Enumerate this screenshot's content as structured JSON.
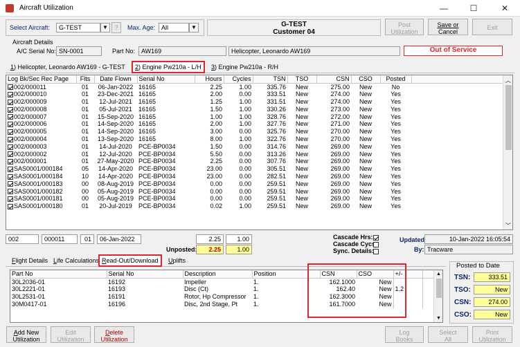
{
  "window": {
    "title": "Aircraft Utilization",
    "minimize": "—",
    "maximize": "☐",
    "close": "✕"
  },
  "header": {
    "select_aircraft_label": "Select Aircraft:",
    "select_aircraft_value": "G-TEST",
    "help": "?",
    "max_age_label": "Max. Age:",
    "max_age_value": "All",
    "aircraft_name": "G-TEST",
    "customer": "Customer 04",
    "post_label_1": "Post",
    "post_label_2": "Utilization",
    "save_label_1": "Save or",
    "save_label_2": "Cancel",
    "exit_label": "Exit"
  },
  "aircraft_details": {
    "group_label": "Aircraft Details",
    "serial_label": "A/C Serial No:",
    "serial_value": "SN-0001",
    "part_label": "Part No:",
    "part_value": "AW169",
    "description": "Helicopter, Leonardo AW169",
    "status": "Out of Service"
  },
  "tabs": [
    {
      "num": "1",
      "label": ") Helicopter, Leonardo AW169 - G-TEST"
    },
    {
      "num": "2",
      "label": ") Engine Pw210a - L/H"
    },
    {
      "num": "3",
      "label": ") Engine Pw210a - R/H"
    }
  ],
  "log_grid": {
    "columns": [
      "Log Bk/Sec Rec Page",
      "Flts",
      "Date Flown",
      "Serial No",
      "Hours",
      "Cycles",
      "TSN",
      "TSO",
      "CSN",
      "CSO",
      "Posted"
    ],
    "rows": [
      [
        "002/000011",
        "01",
        "06-Jan-2022",
        "16165",
        "2.25",
        "1.00",
        "335.76",
        "New",
        "275.00",
        "New",
        "No"
      ],
      [
        "002/000010",
        "01",
        "23-Dec-2021",
        "16165",
        "2.00",
        "0.00",
        "333.51",
        "New",
        "274.00",
        "New",
        "Yes"
      ],
      [
        "002/000009",
        "01",
        "12-Jul-2021",
        "16165",
        "1.25",
        "1.00",
        "331.51",
        "New",
        "274.00",
        "New",
        "Yes"
      ],
      [
        "002/000008",
        "01",
        "05-Jul-2021",
        "16165",
        "1.50",
        "1.00",
        "330.26",
        "New",
        "273.00",
        "New",
        "Yes"
      ],
      [
        "002/000007",
        "01",
        "15-Sep-2020",
        "16165",
        "1.00",
        "1.00",
        "328.76",
        "New",
        "272.00",
        "New",
        "Yes"
      ],
      [
        "002/000006",
        "01",
        "14-Sep-2020",
        "16165",
        "2.00",
        "1.00",
        "327.76",
        "New",
        "271.00",
        "New",
        "Yes"
      ],
      [
        "002/000005",
        "01",
        "14-Sep-2020",
        "16165",
        "3.00",
        "0.00",
        "325.76",
        "New",
        "270.00",
        "New",
        "Yes"
      ],
      [
        "002/000004",
        "01",
        "13-Sep-2020",
        "16165",
        "8.00",
        "1.00",
        "322.76",
        "New",
        "270.00",
        "New",
        "Yes"
      ],
      [
        "002/000003",
        "01",
        "14-Jul-2020",
        "PCE-BP0034",
        "1.50",
        "0.00",
        "314.76",
        "New",
        "269.00",
        "New",
        "Yes"
      ],
      [
        "002/000002",
        "01",
        "12-Jul-2020",
        "PCE-BP0034",
        "5.50",
        "0.00",
        "313.26",
        "New",
        "269.00",
        "New",
        "Yes"
      ],
      [
        "002/000001",
        "01",
        "27-May-2020",
        "PCE-BP0034",
        "2.25",
        "0.00",
        "307.76",
        "New",
        "269.00",
        "New",
        "Yes"
      ],
      [
        "SAS0001/000184",
        "05",
        "14-Apr-2020",
        "PCE-BP0034",
        "23.00",
        "0.00",
        "305.51",
        "New",
        "269.00",
        "New",
        "Yes"
      ],
      [
        "SAS0001/000184",
        "10",
        "14-Apr-2020",
        "PCE-BP0034",
        "23.00",
        "0.00",
        "282.51",
        "New",
        "269.00",
        "New",
        "Yes"
      ],
      [
        "SAS0001/000183",
        "00",
        "08-Aug-2019",
        "PCE-BP0034",
        "0.00",
        "0.00",
        "259.51",
        "New",
        "269.00",
        "New",
        "Yes"
      ],
      [
        "SAS0001/000182",
        "00",
        "05-Aug-2019",
        "PCE-BP0034",
        "0.00",
        "0.00",
        "259.51",
        "New",
        "269.00",
        "New",
        "Yes"
      ],
      [
        "SAS0001/000181",
        "00",
        "05-Aug-2019",
        "PCE-BP0034",
        "0.00",
        "0.00",
        "259.51",
        "New",
        "269.00",
        "New",
        "Yes"
      ],
      [
        "SAS0001/000180",
        "01",
        "20-Jul-2019",
        "PCE-BP0034",
        "0.02",
        "1.00",
        "259.51",
        "New",
        "269.00",
        "New",
        "Yes"
      ]
    ]
  },
  "entry": {
    "log": "002",
    "page": "000011",
    "flts": "01",
    "date": "06-Jan-2022",
    "hours": "2.25",
    "cycles": "1.00",
    "unposted_label": "Unposted:",
    "unposted_hours": "2.25",
    "unposted_cycles": "1.00",
    "cascade_hrs": "Cascade Hrs:",
    "cascade_cycs": "Cascade Cycs:",
    "sync_details": "Sync. Details:",
    "updated_label": "Updated:",
    "updated_value": "10-Jan-2022 16:05:54",
    "by_label": "By:",
    "by_value": "Tracware"
  },
  "bottom_tabs": [
    {
      "u": "F",
      "rest": "light Details"
    },
    {
      "u": "L",
      "rest": "ife Calculations"
    },
    {
      "u": "R",
      "rest": "ead-Out/Download"
    },
    {
      "u": "U",
      "rest": "plifts"
    }
  ],
  "parts_grid": {
    "columns": [
      "Part No",
      "Serial No",
      "Description",
      "Position",
      "CSN",
      "CSO",
      "+/-"
    ],
    "rows": [
      [
        "30L2036-01",
        "16192",
        "Impeller",
        "1.",
        "162.1000",
        "New",
        ""
      ],
      [
        "30L2221-01",
        "16193",
        "Disc (Ct)",
        "1.",
        "162.40",
        "New",
        "1.2"
      ],
      [
        "30L2531-01",
        "16191",
        "Rotor, Hp Compressor",
        "1.",
        "162.3000",
        "New",
        ""
      ],
      [
        "30M0417-01",
        "16196",
        "Disc, 2nd Stage, Pt",
        "1.",
        "161.7000",
        "New",
        ""
      ]
    ]
  },
  "posted_to_date": {
    "title": "Posted to Date",
    "tsn_label": "TSN:",
    "tsn_value": "333.51",
    "tso_label": "TSO:",
    "tso_value": "New",
    "csn_label": "CSN:",
    "csn_value": "274.00",
    "cso_label": "CSO:",
    "cso_value": "New"
  },
  "footer": {
    "add_1": "dd New",
    "add_u": "A",
    "add_2": "Utilization",
    "edit_1": "Edit",
    "edit_2": "Utilization",
    "delete_1": "elete",
    "delete_u": "D",
    "delete_2": "Utilization",
    "log_1": "Log",
    "log_2": "Books",
    "select_1": "Select",
    "select_2": "All",
    "print_1": "Print",
    "print_2": "Utilization"
  }
}
